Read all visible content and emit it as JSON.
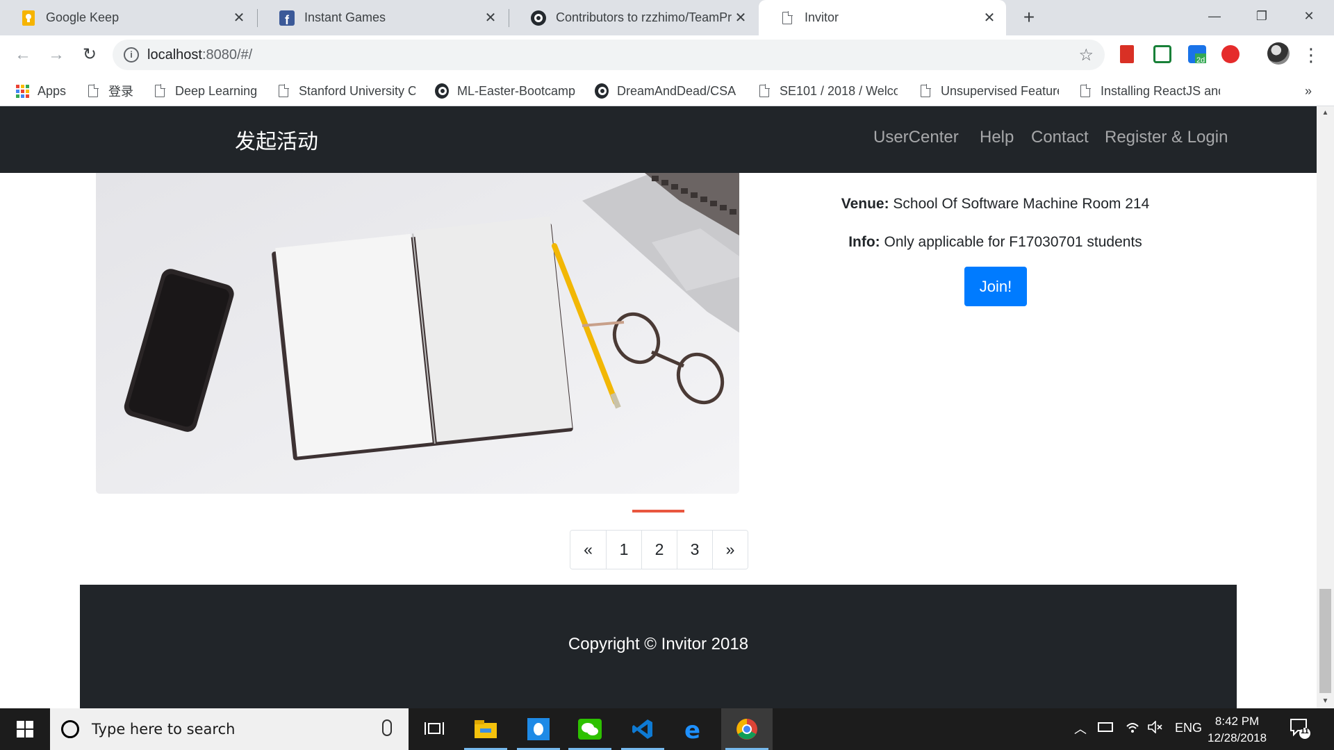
{
  "browser": {
    "tabs": [
      {
        "title": "Google Keep",
        "favicon": "google-keep-icon",
        "active": false
      },
      {
        "title": "Instant Games",
        "favicon": "facebook-icon",
        "active": false
      },
      {
        "title": "Contributors to rzzhimo/TeamPro",
        "favicon": "github-icon",
        "active": false
      },
      {
        "title": "Invitor",
        "favicon": "page-icon",
        "active": true
      }
    ],
    "new_tab": "+",
    "window_controls": {
      "minimize": "—",
      "restore": "❐",
      "close": "✕"
    },
    "url_host": "localhost",
    "url_rest": ":8080/#/",
    "nav": {
      "back": "←",
      "forward": "→",
      "reload": "↻"
    },
    "bookmark_star": "☆",
    "menu": "⋮"
  },
  "bookmarks": [
    {
      "label": "Apps",
      "icon": "apps-grid-icon"
    },
    {
      "label": "登录",
      "icon": "page-icon"
    },
    {
      "label": "Deep Learning",
      "icon": "page-icon"
    },
    {
      "label": "Stanford University C",
      "icon": "page-icon"
    },
    {
      "label": "ML-Easter-Bootcamp",
      "icon": "github-icon"
    },
    {
      "label": "DreamAndDead/CSA",
      "icon": "github-icon"
    },
    {
      "label": "SE101 / 2018 / Welco",
      "icon": "page-icon"
    },
    {
      "label": "Unsupervised Feature",
      "icon": "page-icon"
    },
    {
      "label": "Installing ReactJS and",
      "icon": "page-icon"
    }
  ],
  "bookmarks_overflow": "»",
  "site": {
    "brand": "发起活动",
    "nav_links": [
      "UserCenter",
      "Help",
      "Contact",
      "Register & Login"
    ],
    "event": {
      "venue_label": "Venue:",
      "venue_value": "School Of Software Machine Room 214",
      "info_label": "Info:",
      "info_value": "Only applicable for F17030701 students",
      "join_label": "Join!"
    },
    "pagination": [
      "«",
      "1",
      "2",
      "3",
      "»"
    ],
    "footer": "Copyright © Invitor 2018"
  },
  "taskbar": {
    "search_placeholder": "Type here to search",
    "lang": "ENG",
    "time": "8:42 PM",
    "date": "12/28/2018",
    "notifications": "11"
  },
  "colors": {
    "navbar": "#212529",
    "primary": "#007bff",
    "indicator": "#e9573f"
  }
}
